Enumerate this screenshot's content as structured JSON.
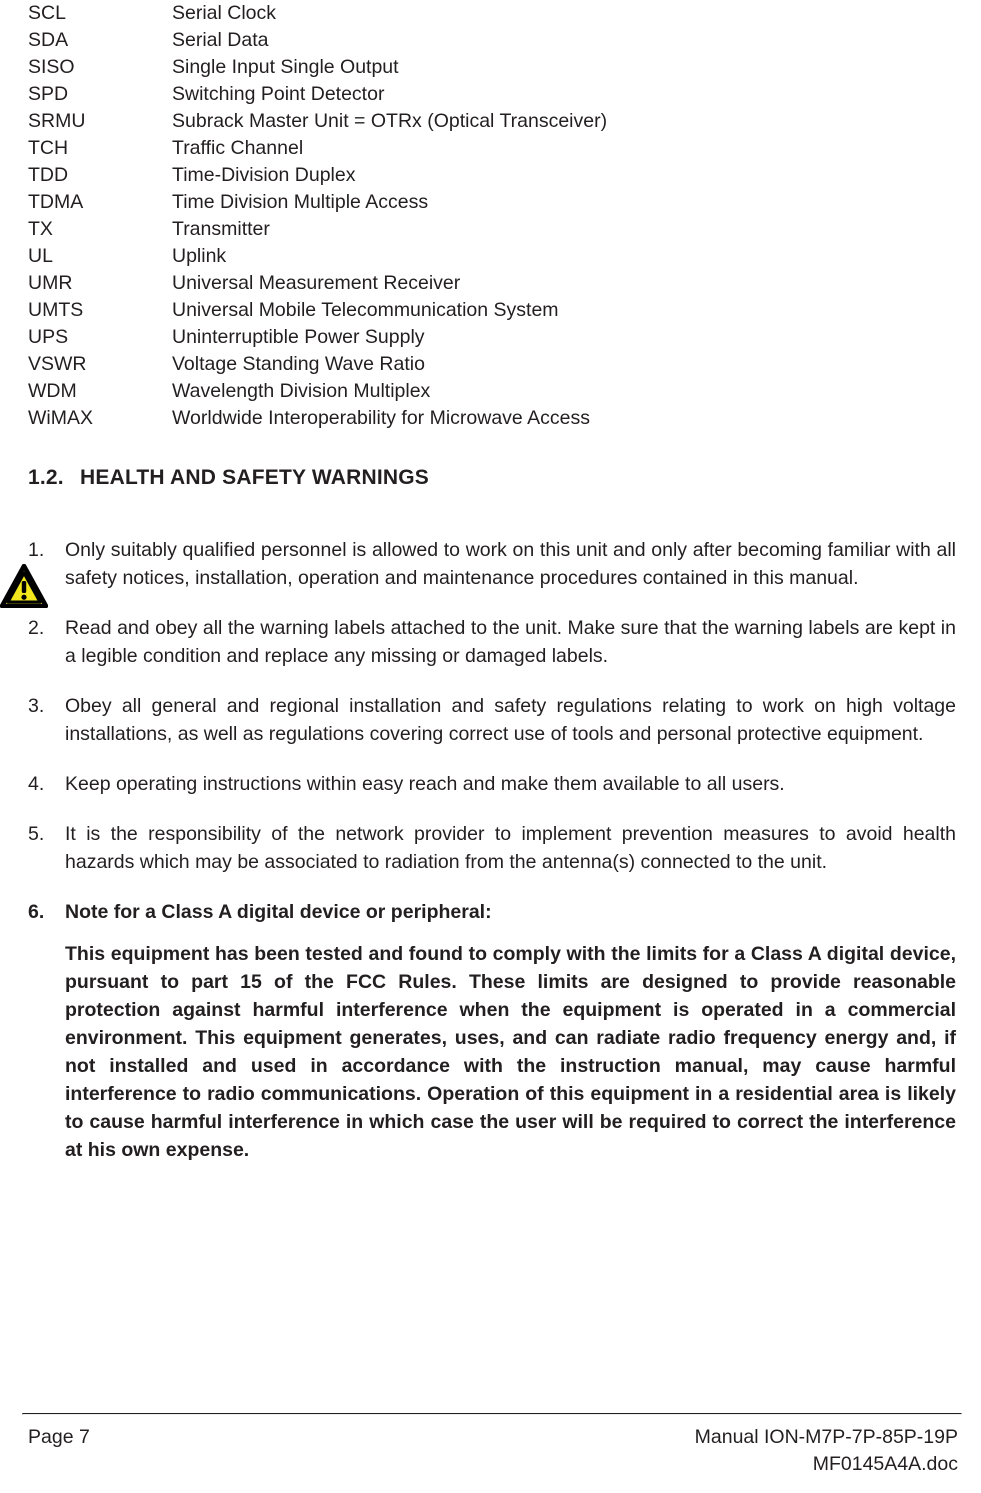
{
  "abbreviations": {
    "rows": [
      {
        "term": "SCL",
        "definition": "Serial Clock"
      },
      {
        "term": "SDA",
        "definition": "Serial Data"
      },
      {
        "term": "SISO",
        "definition": "Single Input Single Output"
      },
      {
        "term": "SPD",
        "definition": "Switching Point Detector"
      },
      {
        "term": "SRMU",
        "definition": "Subrack Master Unit = OTRx (Optical Transceiver)"
      },
      {
        "term": "TCH",
        "definition": "Traffic Channel"
      },
      {
        "term": "TDD",
        "definition": "Time-Division Duplex"
      },
      {
        "term": "TDMA",
        "definition": "Time Division Multiple Access"
      },
      {
        "term": "TX",
        "definition": "Transmitter"
      },
      {
        "term": "UL",
        "definition": "Uplink"
      },
      {
        "term": "UMR",
        "definition": "Universal Measurement Receiver"
      },
      {
        "term": "UMTS",
        "definition": "Universal Mobile Telecommunication System"
      },
      {
        "term": "UPS",
        "definition": "Uninterruptible Power Supply"
      },
      {
        "term": "VSWR",
        "definition": "Voltage Standing Wave Ratio"
      },
      {
        "term": "WDM",
        "definition": "Wavelength Division Multiplex"
      },
      {
        "term": "WiMAX",
        "definition": "Worldwide Interoperability for Microwave Access"
      }
    ]
  },
  "section": {
    "number": "1.2.",
    "title": "HEALTH AND SAFETY WARNINGS"
  },
  "safety_items": [
    {
      "marker": "1.",
      "text": "Only suitably qualified personnel is allowed to work on this unit and only after becoming familiar with all safety notices, installation, operation and maintenance procedures contained in this manual.",
      "icon": "warning-triangle-icon"
    },
    {
      "marker": "2.",
      "text": "Read and obey all the warning labels attached to the unit. Make sure that the warning labels are kept in a legible condition and replace any missing or damaged labels."
    },
    {
      "marker": "3.",
      "text": "Obey all general and regional installation and safety regulations relating to work on high voltage installations, as well as regulations covering correct use of tools and personal protective equipment."
    },
    {
      "marker": "4.",
      "text": "Keep operating instructions within easy reach and make them available to all users."
    },
    {
      "marker": "5.",
      "text": "It is the responsibility of the network provider to implement prevention measures to avoid health hazards which may be associated to radiation from the antenna(s) connected to the unit."
    },
    {
      "marker": "6.",
      "text": "Note for a Class A digital device or peripheral:",
      "sub_paragraph": "This equipment has been tested and found to comply with the limits for a Class A digital device, pursuant to part 15 of the FCC Rules. These limits are designed to provide reasonable protection against harmful interference when the equipment is operated in a commercial environment. This equipment generates, uses, and can radiate radio frequency energy and, if not installed and used in accordance with the instruction manual, may cause harmful interference to radio communications. Operation of this equipment in a residential area is likely to cause harmful interference in which case the user will be required to correct the interference at his own expense."
    }
  ],
  "footer": {
    "page_label": "Page 7",
    "manual_line1": "Manual ION-M7P-7P-85P-19P",
    "manual_line2": "MF0145A4A.doc"
  },
  "colors": {
    "text": "#231f20",
    "warning_fill": "#f2e71d",
    "warning_stroke": "#000000",
    "rule": "#231f20"
  }
}
